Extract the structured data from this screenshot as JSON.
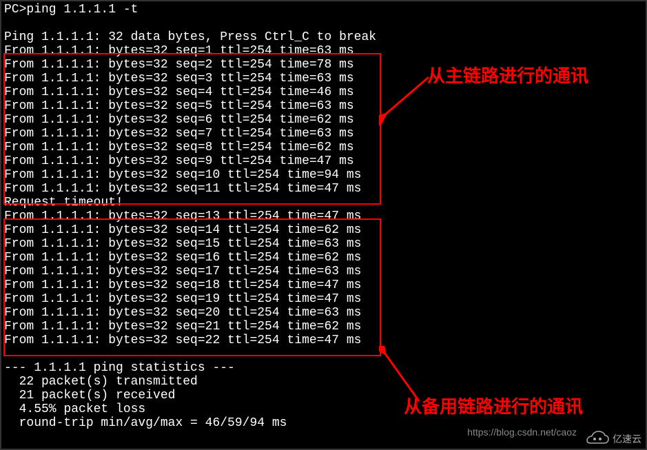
{
  "prompt_line": "PC>ping 1.1.1.1 -t",
  "blank": "",
  "header_line": "Ping 1.1.1.1: 32 data bytes, Press Ctrl_C to break",
  "ping_replies_1": [
    "From 1.1.1.1: bytes=32 seq=1 ttl=254 time=63 ms",
    "From 1.1.1.1: bytes=32 seq=2 ttl=254 time=78 ms",
    "From 1.1.1.1: bytes=32 seq=3 ttl=254 time=63 ms",
    "From 1.1.1.1: bytes=32 seq=4 ttl=254 time=46 ms",
    "From 1.1.1.1: bytes=32 seq=5 ttl=254 time=63 ms",
    "From 1.1.1.1: bytes=32 seq=6 ttl=254 time=62 ms",
    "From 1.1.1.1: bytes=32 seq=7 ttl=254 time=63 ms",
    "From 1.1.1.1: bytes=32 seq=8 ttl=254 time=62 ms",
    "From 1.1.1.1: bytes=32 seq=9 ttl=254 time=47 ms",
    "From 1.1.1.1: bytes=32 seq=10 ttl=254 time=94 ms",
    "From 1.1.1.1: bytes=32 seq=11 ttl=254 time=47 ms"
  ],
  "timeout_line": "Request timeout!",
  "ping_replies_2": [
    "From 1.1.1.1: bytes=32 seq=13 ttl=254 time=47 ms",
    "From 1.1.1.1: bytes=32 seq=14 ttl=254 time=62 ms",
    "From 1.1.1.1: bytes=32 seq=15 ttl=254 time=63 ms",
    "From 1.1.1.1: bytes=32 seq=16 ttl=254 time=62 ms",
    "From 1.1.1.1: bytes=32 seq=17 ttl=254 time=63 ms",
    "From 1.1.1.1: bytes=32 seq=18 ttl=254 time=47 ms",
    "From 1.1.1.1: bytes=32 seq=19 ttl=254 time=47 ms",
    "From 1.1.1.1: bytes=32 seq=20 ttl=254 time=63 ms",
    "From 1.1.1.1: bytes=32 seq=21 ttl=254 time=62 ms",
    "From 1.1.1.1: bytes=32 seq=22 ttl=254 time=47 ms"
  ],
  "stats_header": "--- 1.1.1.1 ping statistics ---",
  "stats_lines": [
    "  22 packet(s) transmitted",
    "  21 packet(s) received",
    "  4.55% packet loss",
    "  round-trip min/avg/max = 46/59/94 ms"
  ],
  "annotations": {
    "primary_link": "从主链路进行的通讯",
    "backup_link": "从备用链路进行的通讯"
  },
  "watermark": {
    "blog_url": "https://blog.csdn.net/caoz",
    "logo_text": "亿速云"
  }
}
